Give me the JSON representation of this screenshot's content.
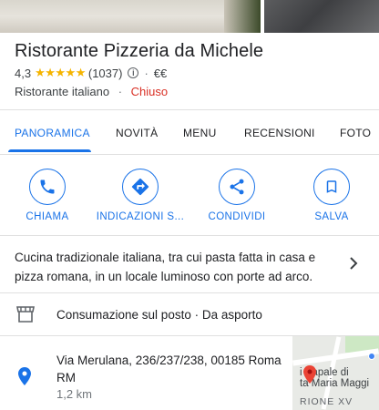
{
  "place": {
    "name": "Ristorante Pizzeria da Michele",
    "rating": "4,3",
    "stars": "★★★★★",
    "reviews_count": "(1037)",
    "price_level": "€€",
    "category": "Ristorante italiano",
    "status": "Chiuso",
    "status_color": "#d93025"
  },
  "tabs": [
    {
      "label": "PANORAMICA",
      "active": true
    },
    {
      "label": "NOVITÀ",
      "active": false
    },
    {
      "label": "MENU",
      "active": false
    },
    {
      "label": "RECENSIONI",
      "active": false
    },
    {
      "label": "FOTO",
      "active": false
    }
  ],
  "actions": [
    {
      "label": "CHIAMA",
      "icon": "phone-icon"
    },
    {
      "label": "INDICAZIONI S...",
      "icon": "directions-icon"
    },
    {
      "label": "CONDIVIDI",
      "icon": "share-icon"
    },
    {
      "label": "SALVA",
      "icon": "bookmark-icon"
    }
  ],
  "description": "Cucina tradizionale italiana, tra cui pasta fatta in casa e pizza romana, in un locale luminoso con porte ad arco.",
  "service_options": "Consumazione sul posto · Da asporto",
  "address": {
    "text": "Via Merulana, 236/237/238, 00185 Roma RM",
    "distance": "1,2 km"
  },
  "map": {
    "label_line1": "i Papale di",
    "label_line2": "ta Maria Maggi",
    "district": "RIONE XV"
  },
  "colors": {
    "accent": "#1a73e8",
    "star": "#f5b400",
    "pin": "#1a73e8",
    "map_pin": "#ea4335"
  }
}
